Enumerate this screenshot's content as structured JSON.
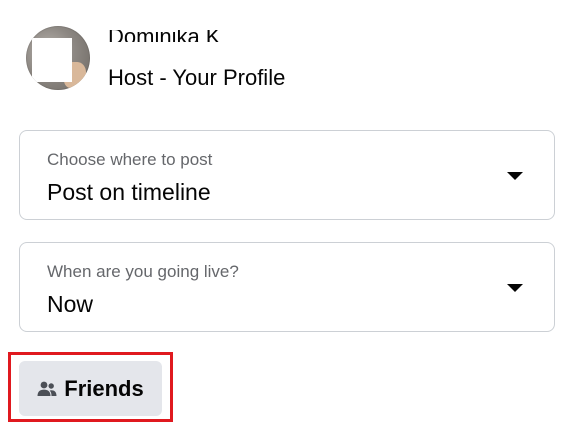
{
  "host": {
    "name": "Dominika K",
    "subtitle": "Host - Your Profile"
  },
  "post_location": {
    "label": "Choose where to post",
    "value": "Post on timeline"
  },
  "schedule": {
    "label": "When are you going live?",
    "value": "Now"
  },
  "audience": {
    "label": "Friends",
    "icon": "friends-icon"
  },
  "colors": {
    "highlight": "#e0191f",
    "button_bg": "#e4e6eb",
    "border": "#ccd0d5",
    "secondary_text": "#65676b"
  }
}
